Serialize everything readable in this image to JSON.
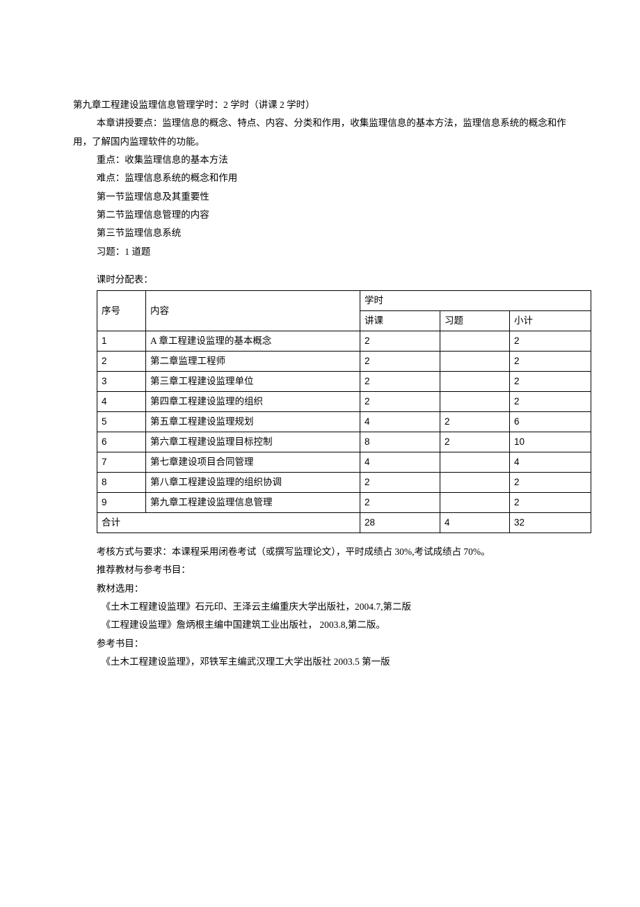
{
  "chapter": {
    "heading": "第九章工程建设监理信息管理学时：2 学时（讲课 2 学时）",
    "points": "本章讲授要点：监理信息的概念、特点、内容、分类和作用，收集监理信息的基本方法，监理信息系统的概念和作用，了解国内监理软件的功能。",
    "focus": "重点：收集监理信息的基本方法",
    "difficulty": "难点：监理信息系统的概念和作用",
    "sec1": "第一节监理信息及其重要性",
    "sec2": "第二节监理信息管理的内容",
    "sec3": "第三节监理信息系统",
    "exercise": "习题：1 道题"
  },
  "allocation": {
    "title": "课时分配表：",
    "header": {
      "idx": "序号",
      "content": "内容",
      "hours": "学时",
      "lecture": "讲课",
      "exercise": "习题",
      "subtotal": "小计"
    },
    "rows": [
      {
        "idx": "1",
        "content": "A 章工程建设监理的基本概念",
        "lecture": "2",
        "exercise": "",
        "subtotal": "2"
      },
      {
        "idx": "2",
        "content": "第二章监理工程师",
        "lecture": "2",
        "exercise": "",
        "subtotal": "2"
      },
      {
        "idx": "3",
        "content": "第三章工程建设监理单位",
        "lecture": "2",
        "exercise": "",
        "subtotal": "2"
      },
      {
        "idx": "4",
        "content": "第四章工程建设监理的组织",
        "lecture": "2",
        "exercise": "",
        "subtotal": "2"
      },
      {
        "idx": "5",
        "content": "第五章工程建设监理规划",
        "lecture": "4",
        "exercise": "2",
        "subtotal": "6"
      },
      {
        "idx": "6",
        "content": "第六章工程建设监理目标控制",
        "lecture": "8",
        "exercise": "2",
        "subtotal": "10"
      },
      {
        "idx": "7",
        "content": "第七章建设项目合同管理",
        "lecture": "4",
        "exercise": "",
        "subtotal": "4"
      },
      {
        "idx": "8",
        "content": "第八章工程建设监理的组织协调",
        "lecture": "2",
        "exercise": "",
        "subtotal": "2"
      },
      {
        "idx": "9",
        "content": "第九章工程建设监理信息管理",
        "lecture": "2",
        "exercise": "",
        "subtotal": "2"
      }
    ],
    "total": {
      "label": "合计",
      "lecture": "28",
      "exercise": "4",
      "subtotal": "32"
    }
  },
  "exam": {
    "line": "考核方式与要求：本课程采用闭卷考试（或撰写监理论文），平时成绩占 30%,考试成绩占 70%。"
  },
  "refs": {
    "recommend": "推荐教材与参考书目：",
    "textbook_label": "教材选用：",
    "tb1": "《土木工程建设监理》石元印、王泽云主编重庆大学出版社，2004.7,第二版",
    "tb2": "《工程建设监理》詹炳根主编中国建筑工业出版社， 2003.8,第二版。",
    "reflist_label": "参考书目：",
    "ref1": "《土木工程建设监理》，邓铁军主编武汉理工大学出版社 2003.5 第一版"
  }
}
